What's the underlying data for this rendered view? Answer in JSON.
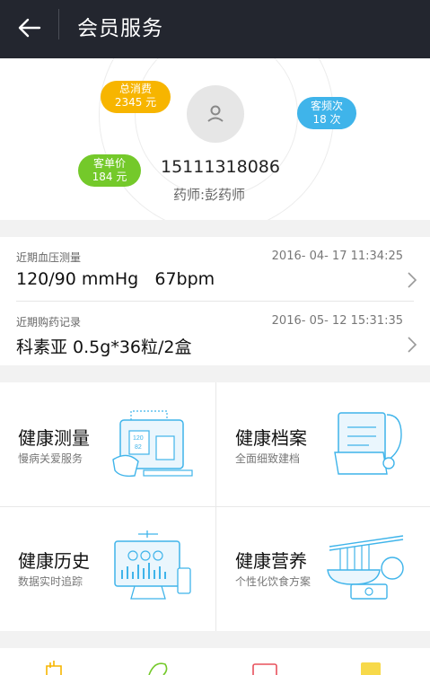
{
  "header": {
    "back_icon": "arrow-left-icon",
    "title": "会员服务"
  },
  "profile": {
    "avatar_icon": "user-icon",
    "total_spend_label": "总消费",
    "total_spend_value": "2345 元",
    "visit_freq_label": "客频次",
    "visit_freq_value": "18 次",
    "unit_price_label": "客单价",
    "unit_price_value": "184 元",
    "phone": "15111318086",
    "pharmacist": "药师:彭药师",
    "colors": {
      "total_spend": "#f7b500",
      "visit_freq": "#3fb4ea",
      "unit_price": "#74c92a"
    }
  },
  "records": [
    {
      "label": "近期血压测量",
      "date": "2016- 04- 17 11:34:25",
      "value": "120/90 mmHg   67bpm"
    },
    {
      "label": "近期购药记录",
      "date": "2016- 05- 12 15:31:35",
      "value": "科素亚 0.5g*36粒/2盒"
    }
  ],
  "services": [
    {
      "title": "健康测量",
      "subtitle": "慢病关爱服务",
      "icon": "health-measurement-icon"
    },
    {
      "title": "健康档案",
      "subtitle": "全面细致建档",
      "icon": "health-record-icon"
    },
    {
      "title": "健康历史",
      "subtitle": "数据实时追踪",
      "icon": "health-history-icon"
    },
    {
      "title": "健康营养",
      "subtitle": "个性化饮食方案",
      "icon": "health-nutrition-icon"
    }
  ],
  "tabbar": {
    "icons": [
      "tab-icon-1",
      "tab-icon-2",
      "tab-icon-3",
      "tab-icon-4"
    ]
  },
  "theme": {
    "header_bg": "#23262f",
    "accent_blue": "#3fb4ea"
  }
}
